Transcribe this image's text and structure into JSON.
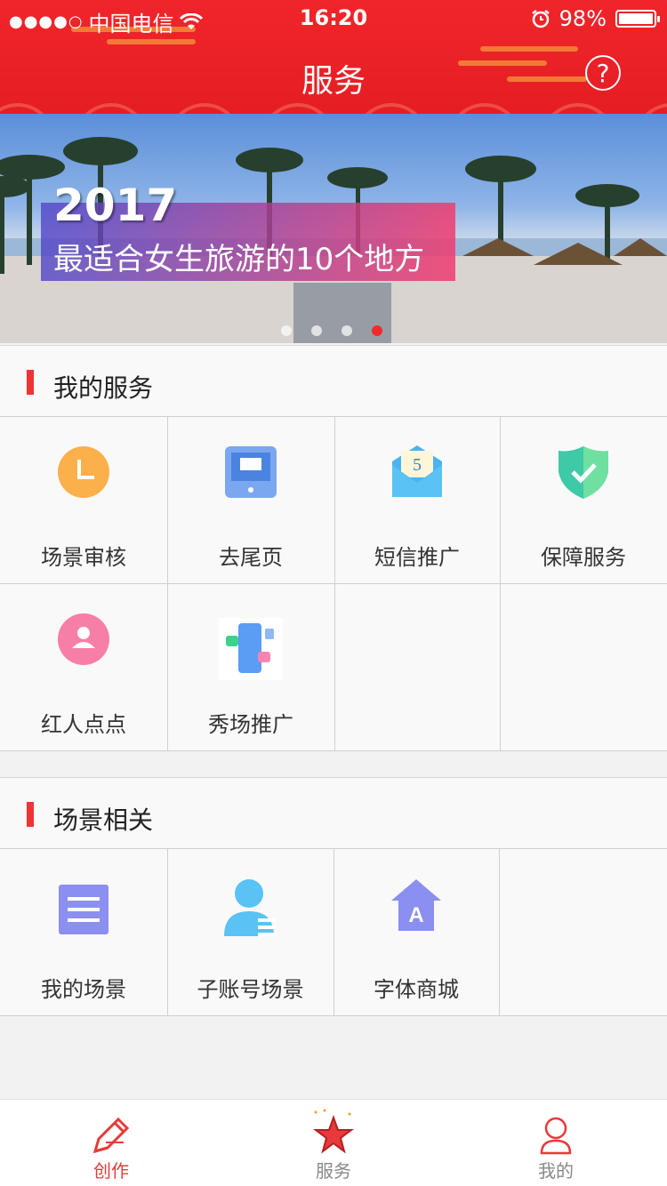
{
  "status_bar": {
    "signal": "●●●●○",
    "carrier": "中国电信",
    "time": "16:20",
    "battery_percent": "98%",
    "battery_level": 0.98
  },
  "header": {
    "title": "服务",
    "help_label": "?"
  },
  "banner": {
    "year": "2017",
    "subtitle": "最适合女生旅游的10个地方",
    "page_count": 4,
    "active_page": 4
  },
  "sections": {
    "my_services": {
      "title": "我的服务",
      "items": [
        {
          "label": "场景审核",
          "icon": "clock-icon"
        },
        {
          "label": "去尾页",
          "icon": "tablet-icon"
        },
        {
          "label": "短信推广",
          "icon": "envelope-icon"
        },
        {
          "label": "保障服务",
          "icon": "shield-check-icon"
        },
        {
          "label": "红人点点",
          "icon": "person-circle-icon"
        },
        {
          "label": "秀场推广",
          "icon": "phone-share-icon"
        }
      ]
    },
    "scene_related": {
      "title": "场景相关",
      "items": [
        {
          "label": "我的场景",
          "icon": "document-list-icon"
        },
        {
          "label": "子账号场景",
          "icon": "sub-account-icon"
        },
        {
          "label": "字体商城",
          "icon": "font-store-icon"
        }
      ]
    }
  },
  "tabbar": {
    "items": [
      {
        "label": "创作",
        "icon": "pencil-icon",
        "active": true
      },
      {
        "label": "服务",
        "icon": "star-icon",
        "active": false
      },
      {
        "label": "我的",
        "icon": "user-icon",
        "active": false
      }
    ]
  },
  "colors": {
    "brand_red": "#e51e23",
    "accent_bar": "#f03434",
    "active_tab": "#e83a3a"
  }
}
